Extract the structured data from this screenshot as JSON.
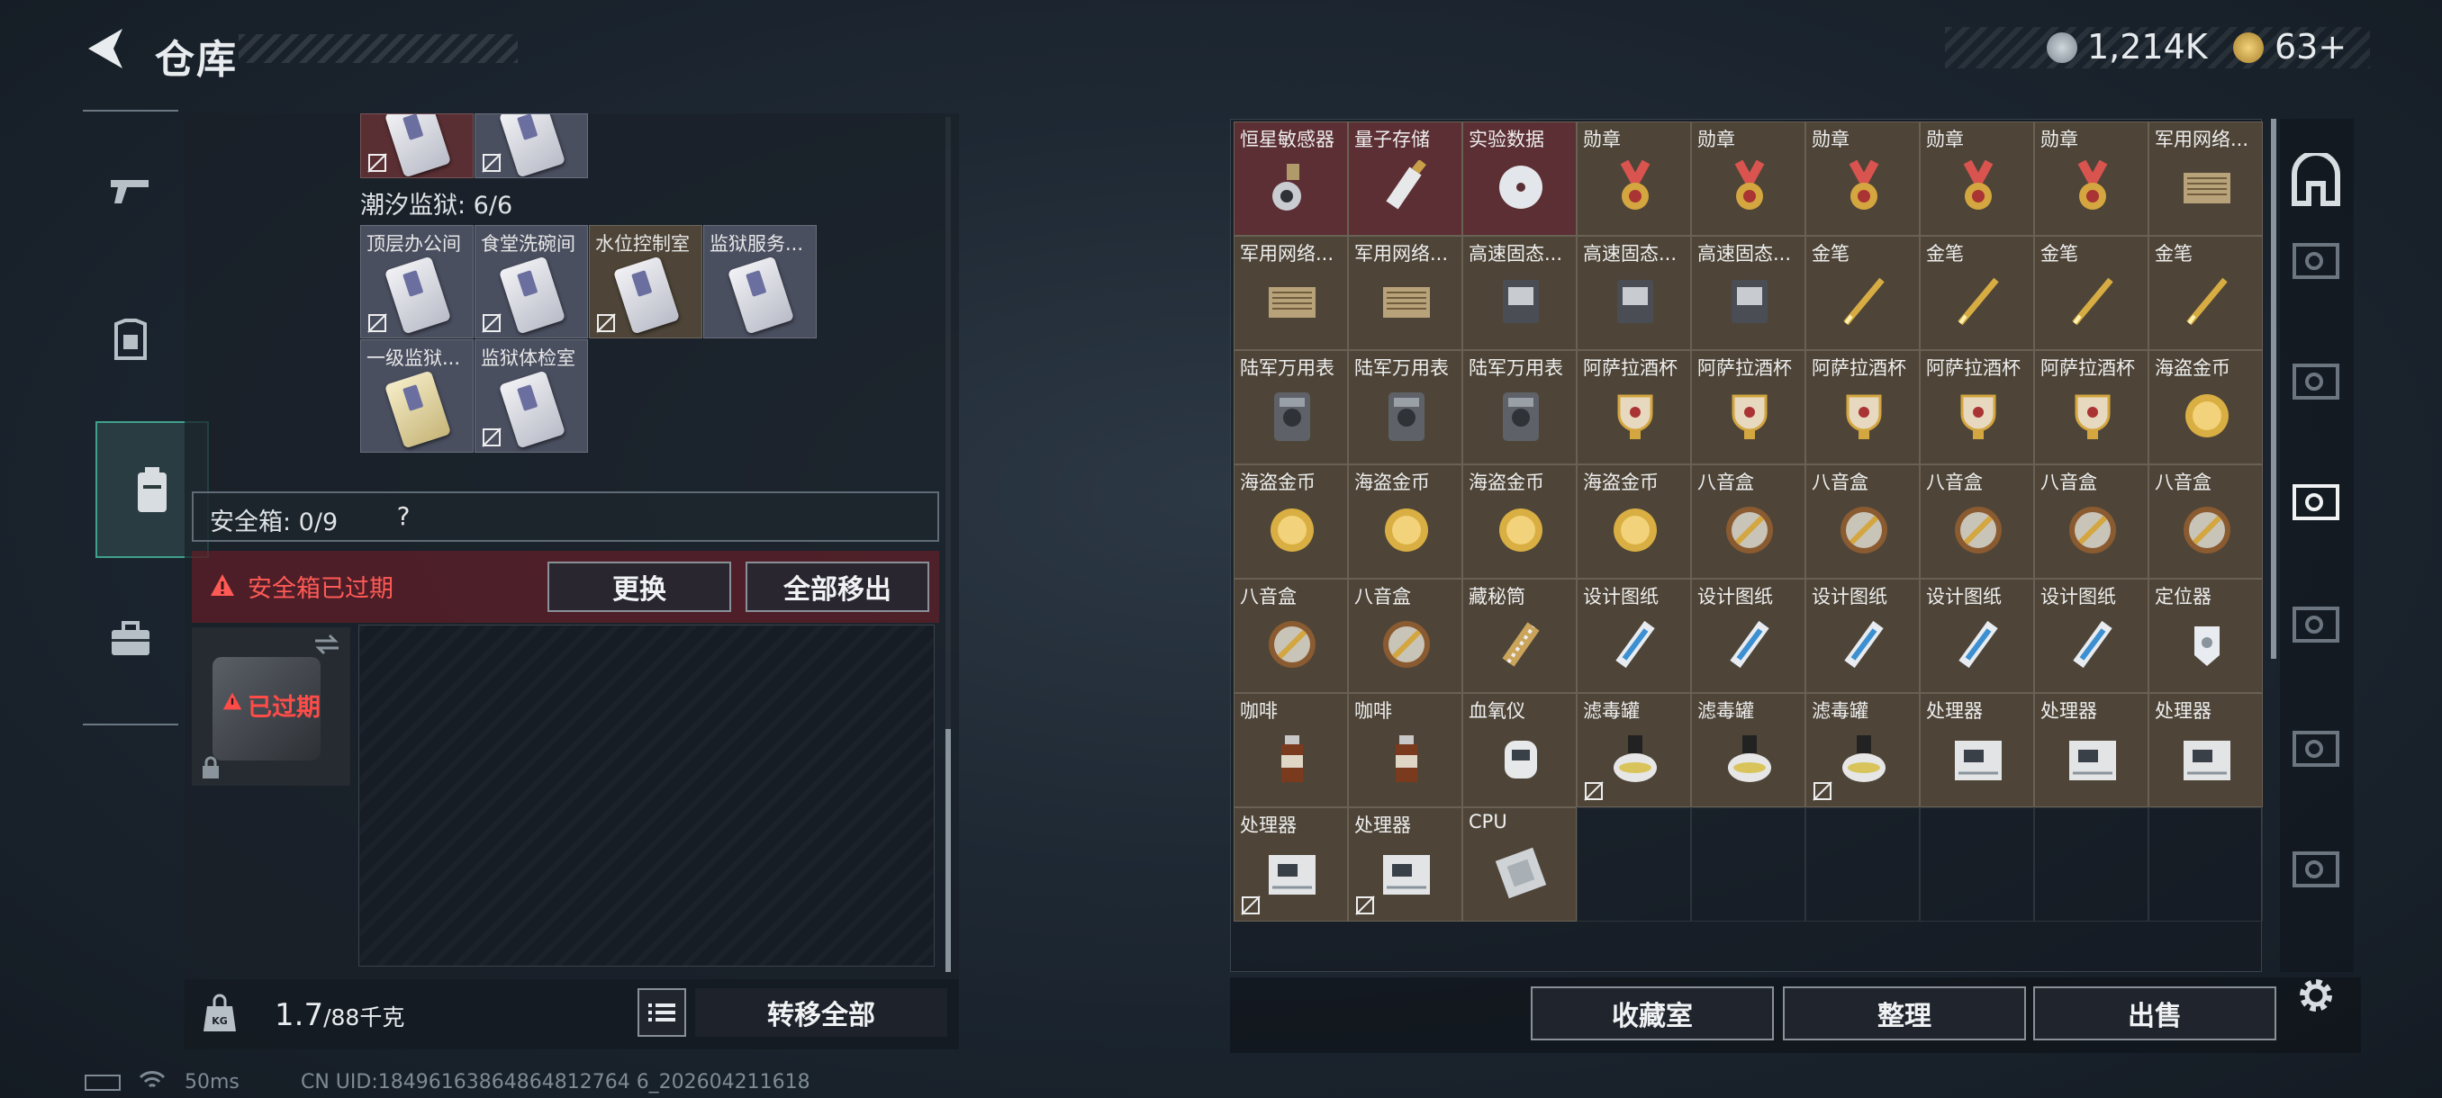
{
  "header": {
    "title": "仓库",
    "currency1": "1,214K",
    "currency2": "63+"
  },
  "colors": {
    "accent": "#3fa08c",
    "alert": "#ff5a55",
    "item_bg": "#4e4538",
    "item_red": "#5c2f34"
  },
  "left_tabs": [
    {
      "name": "weapon-tab",
      "icon": "gun-icon"
    },
    {
      "name": "armor-tab",
      "icon": "armor-icon"
    },
    {
      "name": "backpack-tab",
      "icon": "backpack-icon",
      "active": true
    },
    {
      "name": "case-tab",
      "icon": "briefcase-icon"
    }
  ],
  "keys_section": {
    "label": "潮汐监狱: 6/6",
    "cards": [
      "顶层办公间",
      "食堂洗碗间",
      "水位控制室",
      "监狱服务...",
      "一级监狱...",
      "监狱体检室"
    ]
  },
  "safe_box": {
    "label": "安全箱: 0/9",
    "help": "?",
    "alert": "安全箱已过期",
    "replace_button": "更换",
    "remove_all_button": "全部移出",
    "expired_label": "已过期"
  },
  "inventory_footer": {
    "weight": "1.7",
    "weight_max": "/88千克",
    "transfer_all_button": "转移全部"
  },
  "stash_items": [
    [
      "恒星敏感器",
      "量子存储",
      "实验数据",
      "勋章",
      "勋章",
      "勋章",
      "勋章",
      "勋章",
      "军用网络..."
    ],
    [
      "军用网络...",
      "军用网络...",
      "高速固态...",
      "高速固态...",
      "高速固态...",
      "金笔",
      "金笔",
      "金笔",
      "金笔"
    ],
    [
      "陆军万用表",
      "陆军万用表",
      "陆军万用表",
      "阿萨拉酒杯",
      "阿萨拉酒杯",
      "阿萨拉酒杯",
      "阿萨拉酒杯",
      "阿萨拉酒杯",
      "海盗金币"
    ],
    [
      "海盗金币",
      "海盗金币",
      "海盗金币",
      "海盗金币",
      "八音盒",
      "八音盒",
      "八音盒",
      "八音盒",
      "八音盒"
    ],
    [
      "八音盒",
      "八音盒",
      "藏秘筒",
      "设计图纸",
      "设计图纸",
      "设计图纸",
      "设计图纸",
      "设计图纸",
      "定位器"
    ],
    [
      "咖啡",
      "咖啡",
      "血氧仪",
      "滤毒罐",
      "滤毒罐",
      "滤毒罐",
      "处理器",
      "处理器",
      "处理器"
    ],
    [
      "处理器",
      "处理器",
      "CPU"
    ]
  ],
  "stash_buttons": {
    "collection": "收藏室",
    "sort": "整理",
    "sell": "出售"
  },
  "status": {
    "ping": "50ms",
    "uid": "CN UID:18496163864864812764 6_202604211618"
  }
}
